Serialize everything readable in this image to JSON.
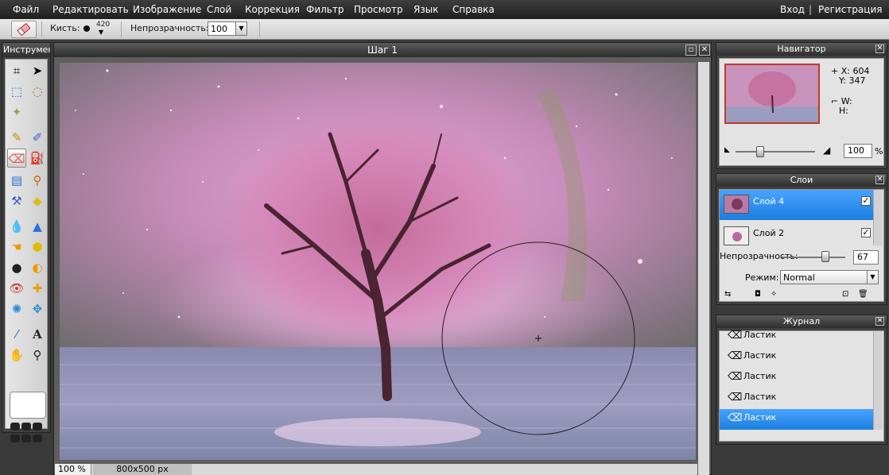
{
  "menu": {
    "items": [
      "Файл",
      "Редактировать",
      "Изображение",
      "Слой",
      "Коррекция",
      "Фильтр",
      "Просмотр",
      "Язык",
      "Справка"
    ],
    "login": "Вход",
    "separator": "|",
    "register": "Регистрация"
  },
  "options": {
    "brush_label": "Кисть:",
    "brush_size": "420",
    "opacity_label": "Непрозрачность:",
    "opacity_value": "100"
  },
  "tools": {
    "title": "Инструменты"
  },
  "document": {
    "title": "Шаг 1",
    "zoom": "100 %",
    "size": "800x500 px"
  },
  "navigator": {
    "title": "Навигатор",
    "x_label": "X:",
    "x_value": "604",
    "y_label": "Y:",
    "y_value": "347",
    "w_label": "W:",
    "h_label": "H:",
    "zoom_value": "100",
    "zoom_unit": "%"
  },
  "layers": {
    "title": "Слои",
    "items": [
      {
        "name": "Слой 4",
        "selected": true,
        "visible": true
      },
      {
        "name": "Слой 2",
        "selected": false,
        "visible": true
      }
    ],
    "opacity_label": "Непрозрачность:",
    "opacity_value": "67",
    "mode_label": "Режим:",
    "mode_value": "Normal"
  },
  "history": {
    "title": "Журнал",
    "items": [
      "Ластик",
      "Ластик",
      "Ластик",
      "Ластик",
      "Ластик"
    ],
    "selected_index": 4
  }
}
